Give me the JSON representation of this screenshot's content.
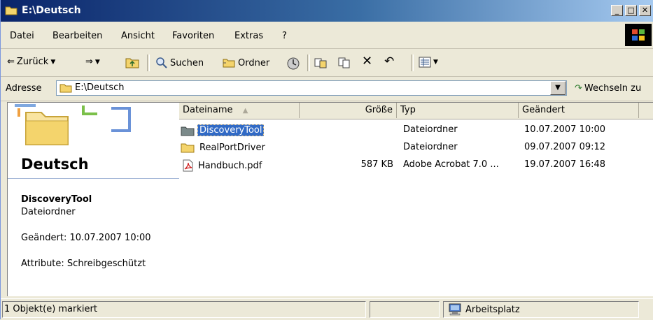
{
  "window": {
    "title": "E:\\Deutsch"
  },
  "menu": [
    "Datei",
    "Bearbeiten",
    "Ansicht",
    "Favoriten",
    "Extras",
    "?"
  ],
  "toolbar": {
    "back": "Zurück",
    "search": "Suchen",
    "folders": "Ordner"
  },
  "address": {
    "label": "Adresse",
    "value": "E:\\Deutsch",
    "go": "Wechseln zu"
  },
  "leftpane": {
    "title": "Deutsch",
    "selected_name": "DiscoveryTool",
    "selected_type": "Dateiordner",
    "changed": "Geändert: 10.07.2007 10:00",
    "attributes": "Attribute: Schreibgeschützt"
  },
  "columns": {
    "name": "Dateiname",
    "size": "Größe",
    "type": "Typ",
    "modified": "Geändert"
  },
  "files": [
    {
      "name": "DiscoveryTool",
      "size": "",
      "type": "Dateiordner",
      "modified": "10.07.2007 10:00",
      "icon": "folder-icon",
      "selected": true
    },
    {
      "name": "RealPortDriver",
      "size": "",
      "type": "Dateiordner",
      "modified": "09.07.2007 09:12",
      "icon": "folder-icon",
      "selected": false
    },
    {
      "name": "Handbuch.pdf",
      "size": "587 KB",
      "type": "Adobe Acrobat 7.0 ...",
      "modified": "19.07.2007 16:48",
      "icon": "pdf-icon",
      "selected": false
    }
  ],
  "status": {
    "selection": "1 Objekt(e) markiert",
    "location": "Arbeitsplatz"
  },
  "colors": {
    "title_start": "#0a246a",
    "title_end": "#a6caf0",
    "selection": "#316ac5",
    "folder": "#f4d46c"
  }
}
